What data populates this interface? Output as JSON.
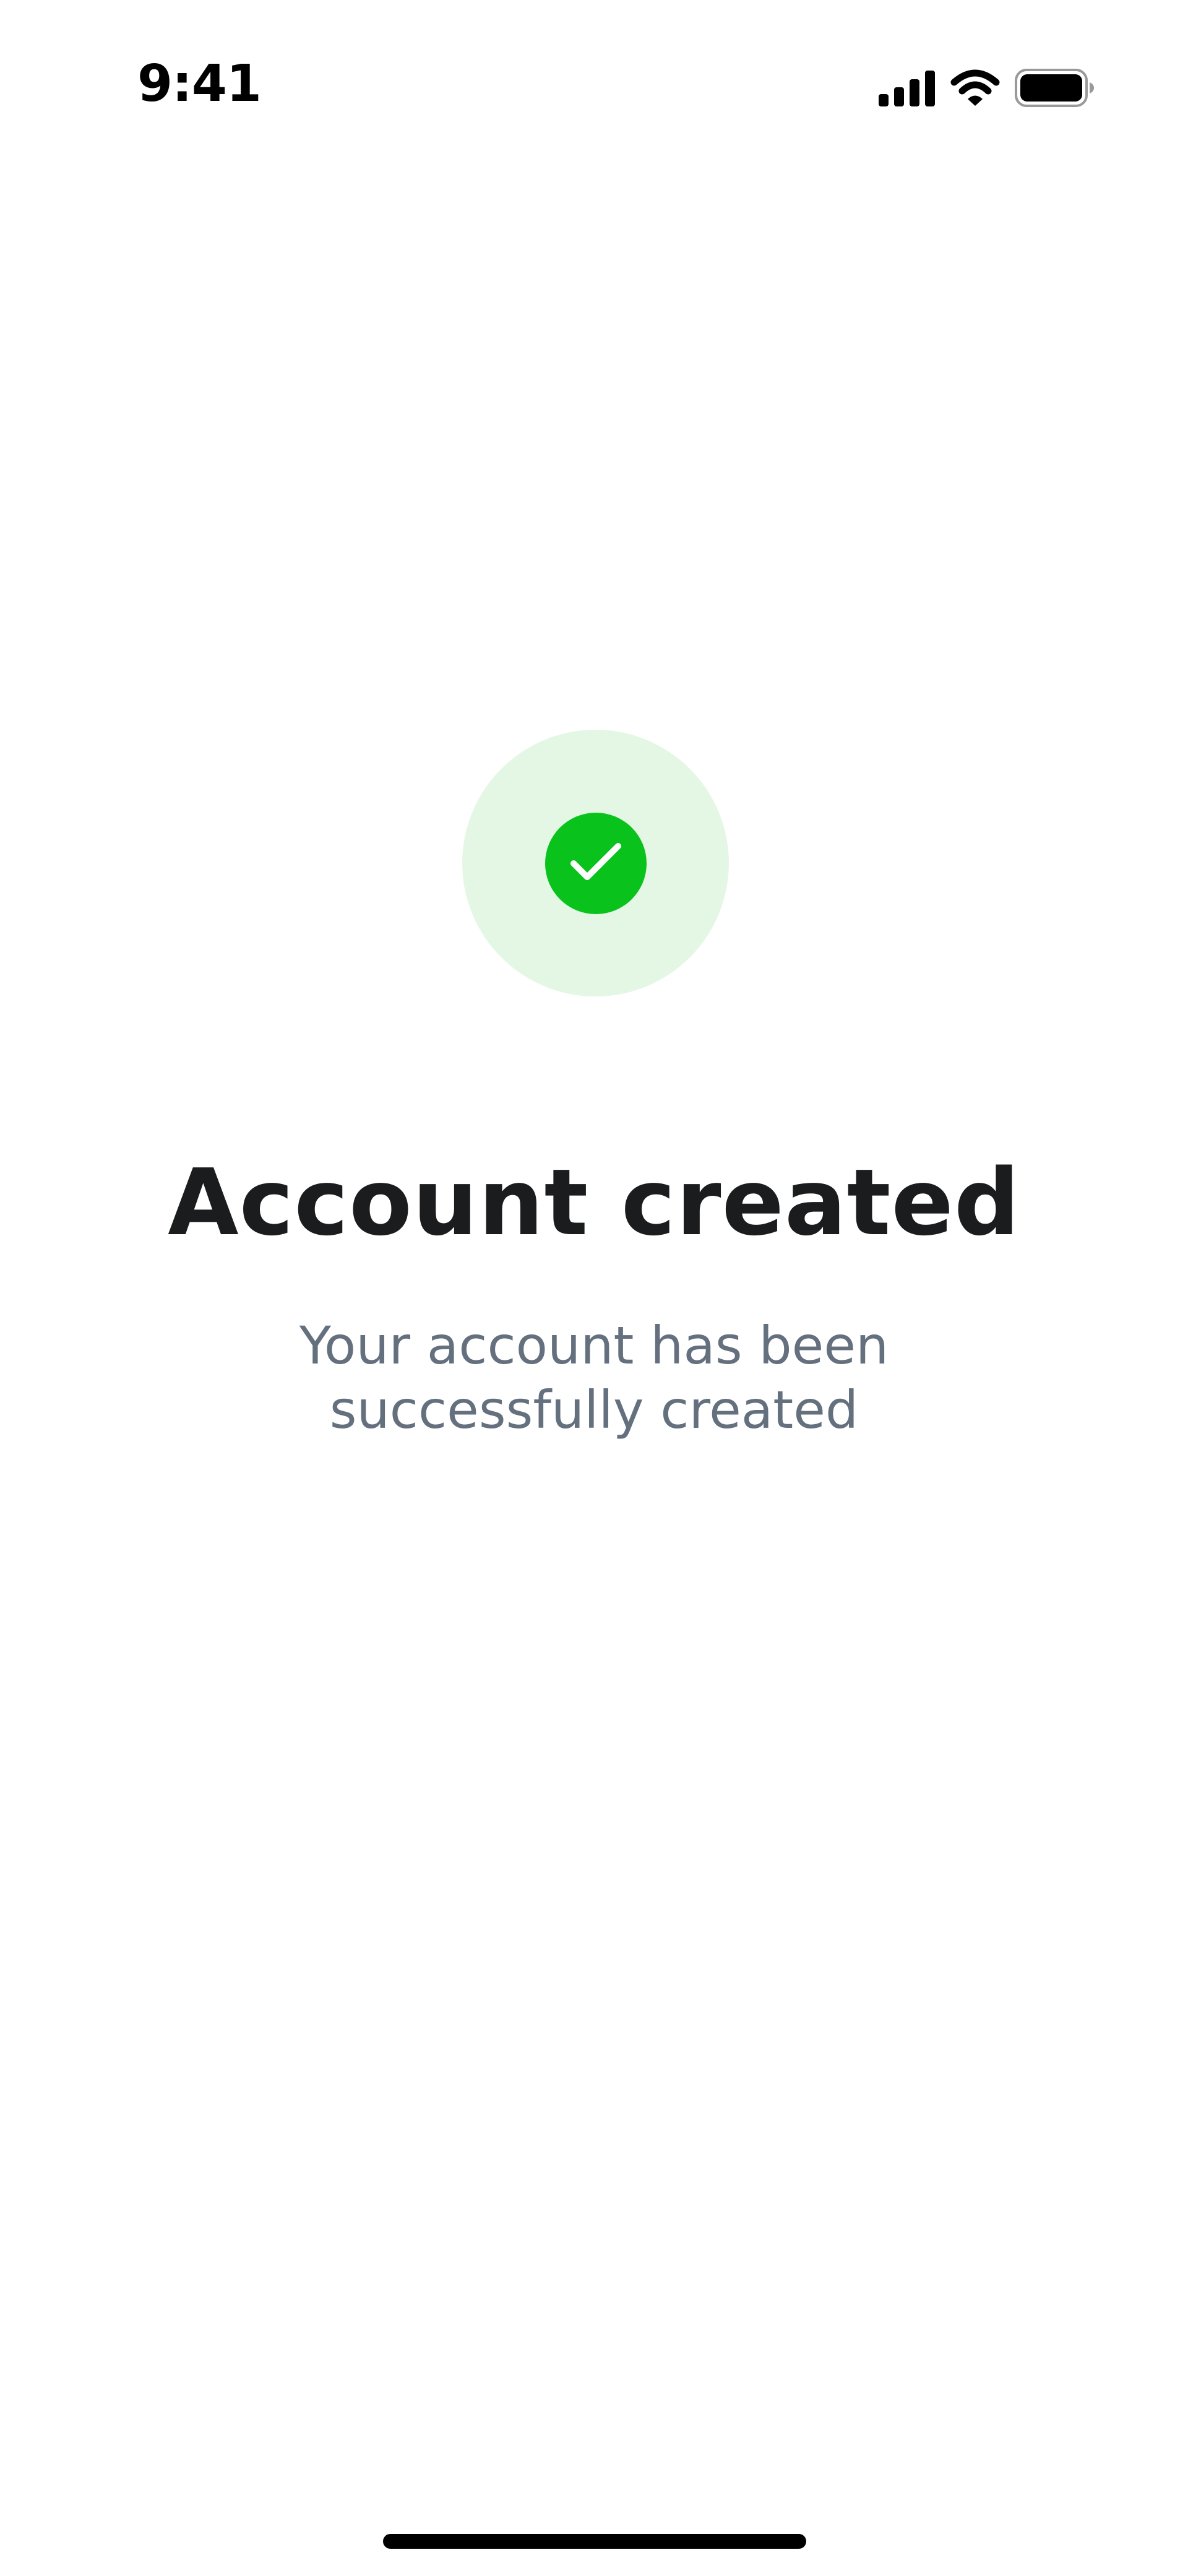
{
  "status_bar": {
    "time": "9:41",
    "icons": [
      "cellular-signal-icon",
      "wifi-icon",
      "battery-icon"
    ]
  },
  "success": {
    "icon": "checkmark-icon",
    "colors": {
      "badge_outer": "#e4f7e5",
      "badge_inner": "#0ac21c",
      "check": "#ffffff"
    }
  },
  "main": {
    "title": "Account created",
    "subtitle_line1": "Your account has been",
    "subtitle_line2": "successfully created"
  },
  "colors": {
    "title": "#1b1c1e",
    "subtitle": "#65707f",
    "background": "#ffffff"
  }
}
